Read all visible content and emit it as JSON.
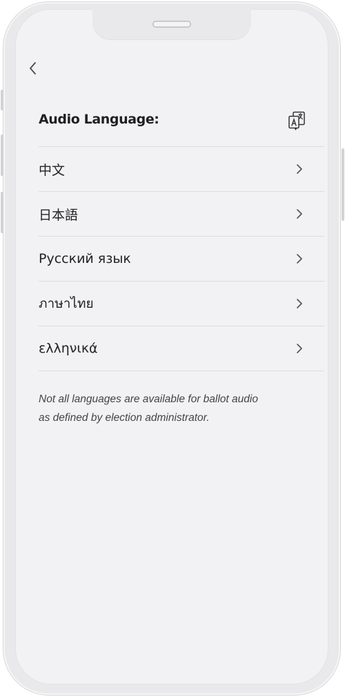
{
  "header": {
    "title": "Audio Language:"
  },
  "languages": [
    {
      "label": "中文"
    },
    {
      "label": "日本語"
    },
    {
      "label": "Русский язык"
    },
    {
      "label": "ภาษาไทย"
    },
    {
      "label": "ελληνικά"
    }
  ],
  "note": {
    "line1": "Not all languages are available for ballot audio",
    "line2": "as defined by election administrator."
  },
  "colors": {
    "background": "#f2f2f4",
    "frame": "#e9e9eb",
    "divider": "#dcdcde",
    "text": "#222222"
  },
  "icons": {
    "back": "chevron-left-icon",
    "translate": "translate-icon",
    "row": "chevron-right-icon"
  }
}
